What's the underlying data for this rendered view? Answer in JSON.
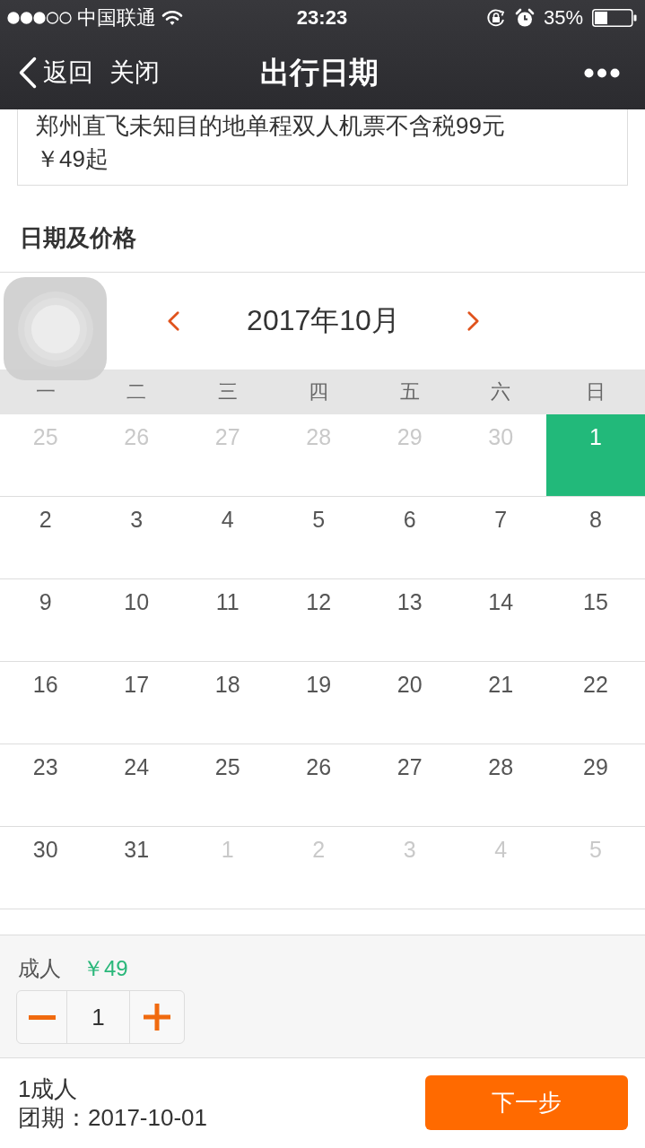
{
  "status_bar": {
    "carrier": "中国联通",
    "time": "23:23",
    "battery": "35%"
  },
  "nav": {
    "back": "返回",
    "close": "关闭",
    "title": "出行日期"
  },
  "product": {
    "title": "郑州直飞未知目的地单程双人机票不含税99元",
    "price": "￥49起"
  },
  "section_title": "日期及价格",
  "calendar": {
    "month": "2017年10月",
    "weekdays": [
      "一",
      "二",
      "三",
      "四",
      "五",
      "六",
      "日"
    ],
    "weeks": [
      [
        {
          "day": "25",
          "in_month": false,
          "selected": false
        },
        {
          "day": "26",
          "in_month": false,
          "selected": false
        },
        {
          "day": "27",
          "in_month": false,
          "selected": false
        },
        {
          "day": "28",
          "in_month": false,
          "selected": false
        },
        {
          "day": "29",
          "in_month": false,
          "selected": false
        },
        {
          "day": "30",
          "in_month": false,
          "selected": false
        },
        {
          "day": "1",
          "in_month": true,
          "selected": true
        }
      ],
      [
        {
          "day": "2",
          "in_month": true,
          "selected": false
        },
        {
          "day": "3",
          "in_month": true,
          "selected": false
        },
        {
          "day": "4",
          "in_month": true,
          "selected": false
        },
        {
          "day": "5",
          "in_month": true,
          "selected": false
        },
        {
          "day": "6",
          "in_month": true,
          "selected": false
        },
        {
          "day": "7",
          "in_month": true,
          "selected": false
        },
        {
          "day": "8",
          "in_month": true,
          "selected": false
        }
      ],
      [
        {
          "day": "9",
          "in_month": true,
          "selected": false
        },
        {
          "day": "10",
          "in_month": true,
          "selected": false
        },
        {
          "day": "11",
          "in_month": true,
          "selected": false
        },
        {
          "day": "12",
          "in_month": true,
          "selected": false
        },
        {
          "day": "13",
          "in_month": true,
          "selected": false
        },
        {
          "day": "14",
          "in_month": true,
          "selected": false
        },
        {
          "day": "15",
          "in_month": true,
          "selected": false
        }
      ],
      [
        {
          "day": "16",
          "in_month": true,
          "selected": false
        },
        {
          "day": "17",
          "in_month": true,
          "selected": false
        },
        {
          "day": "18",
          "in_month": true,
          "selected": false
        },
        {
          "day": "19",
          "in_month": true,
          "selected": false
        },
        {
          "day": "20",
          "in_month": true,
          "selected": false
        },
        {
          "day": "21",
          "in_month": true,
          "selected": false
        },
        {
          "day": "22",
          "in_month": true,
          "selected": false
        }
      ],
      [
        {
          "day": "23",
          "in_month": true,
          "selected": false
        },
        {
          "day": "24",
          "in_month": true,
          "selected": false
        },
        {
          "day": "25",
          "in_month": true,
          "selected": false
        },
        {
          "day": "26",
          "in_month": true,
          "selected": false
        },
        {
          "day": "27",
          "in_month": true,
          "selected": false
        },
        {
          "day": "28",
          "in_month": true,
          "selected": false
        },
        {
          "day": "29",
          "in_month": true,
          "selected": false
        }
      ],
      [
        {
          "day": "30",
          "in_month": true,
          "selected": false
        },
        {
          "day": "31",
          "in_month": true,
          "selected": false
        },
        {
          "day": "1",
          "in_month": false,
          "selected": false
        },
        {
          "day": "2",
          "in_month": false,
          "selected": false
        },
        {
          "day": "3",
          "in_month": false,
          "selected": false
        },
        {
          "day": "4",
          "in_month": false,
          "selected": false
        },
        {
          "day": "5",
          "in_month": false,
          "selected": false
        }
      ]
    ]
  },
  "ticket": {
    "label": "成人",
    "price": "￥49",
    "quantity": "1"
  },
  "summary": {
    "travelers": "1成人",
    "date": "团期：2017-10-01"
  },
  "next_button": "下一步"
}
